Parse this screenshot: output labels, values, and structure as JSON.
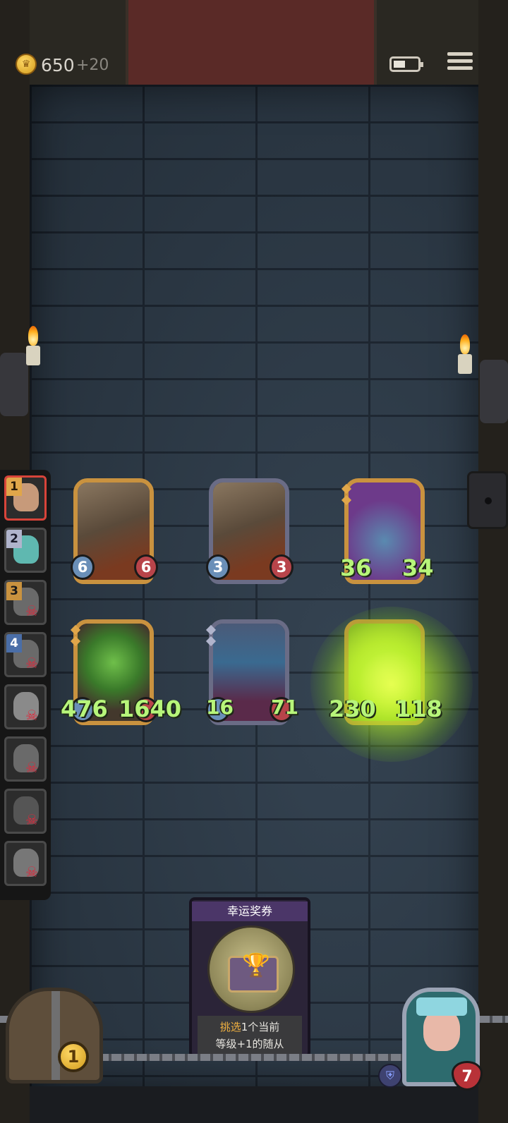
{
  "hud": {
    "gold": "650",
    "gold_bonus": "+20"
  },
  "roster": [
    {
      "rank": "1",
      "status": "active"
    },
    {
      "rank": "2",
      "status": "alive"
    },
    {
      "rank": "3",
      "status": "dead"
    },
    {
      "rank": "4",
      "status": "dead"
    },
    {
      "rank": "",
      "status": "dead"
    },
    {
      "rank": "",
      "status": "dead"
    },
    {
      "rank": "",
      "status": "dead"
    },
    {
      "rank": "",
      "status": "dead"
    }
  ],
  "board": {
    "row1": [
      {
        "name": "missile-unit",
        "attack": "6",
        "health": "6"
      },
      {
        "name": "missile-unit",
        "attack": "3",
        "health": "3"
      },
      {
        "name": "thorn-plant-unit",
        "attack": "36",
        "health": "34"
      }
    ],
    "row2": [
      {
        "name": "sprout-kid-unit",
        "attack": "476",
        "health": "1640"
      },
      {
        "name": "elf-sorceress-unit",
        "attack": "16",
        "health": "71"
      },
      {
        "name": "glowing-unit",
        "attack": "230",
        "health": "118"
      }
    ]
  },
  "reward": {
    "title": "幸运奖券",
    "desc_highlight": "挑选",
    "desc_line1_rest": "1个当前",
    "desc_line2": "等级+1的随从"
  },
  "chest": {
    "coins": "1"
  },
  "hero": {
    "health": "7"
  },
  "colors": {
    "wall": "#2f3d4b",
    "gold_frame": "#c9923f",
    "silver_frame": "#6a6c86",
    "stat_green": "#b7f57a",
    "dead_skull": "#e2263a"
  },
  "icons": [
    "crown-coin-icon",
    "battery-icon",
    "menu-icon",
    "skull-icon",
    "trophy-icon",
    "shield-icon",
    "heart-icon",
    "torch-icon"
  ]
}
